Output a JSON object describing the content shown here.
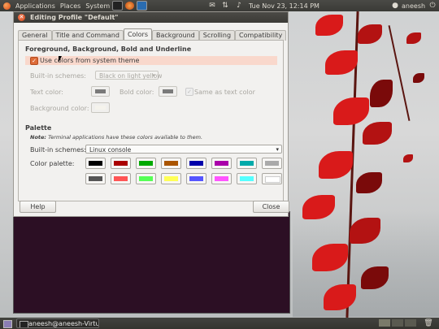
{
  "top_panel": {
    "menus": [
      "Applications",
      "Places",
      "System"
    ],
    "clock": "Tue Nov 23, 12:14 PM",
    "user": "aneesh"
  },
  "dialog": {
    "title": "Editing Profile \"Default\"",
    "tabs": [
      "General",
      "Title and Command",
      "Colors",
      "Background",
      "Scrolling",
      "Compatibility"
    ],
    "active_tab": "Colors",
    "fg_section": {
      "heading": "Foreground, Background, Bold and Underline",
      "use_system_theme_label": "Use colors from system theme",
      "use_system_theme_checked": true,
      "builtin_schemes_label": "Built-in schemes:",
      "builtin_schemes_value": "Black on light yellow",
      "text_color_label": "Text color:",
      "text_color": "#7a7a7a",
      "bold_color_label": "Bold color:",
      "bold_color": "#7a7a7a",
      "same_as_text_label": "Same as text color",
      "same_as_text_checked": true,
      "background_color_label": "Background color:",
      "background_color": "#f5f3ec"
    },
    "palette_section": {
      "heading": "Palette",
      "note_bold": "Note:",
      "note_text": " Terminal applications have these colors available to them.",
      "builtin_schemes_label": "Built-in schemes:",
      "builtin_schemes_value": "Linux console",
      "color_palette_label": "Color palette:",
      "row1": [
        "#000000",
        "#aa0000",
        "#00aa00",
        "#aa5500",
        "#0000aa",
        "#aa00aa",
        "#00aaaa",
        "#aaaaaa"
      ],
      "row2": [
        "#555555",
        "#ff5555",
        "#55ff55",
        "#ffff55",
        "#5555ff",
        "#ff55ff",
        "#55ffff",
        "#ffffff"
      ]
    },
    "help_button": "Help",
    "close_button": "Close"
  },
  "taskbar": {
    "task_label": "aneesh@aneesh-Virtu..."
  },
  "colors": {
    "accent": "#dd4814",
    "terminal_bg": "#2c0f24",
    "panel_bg": "#3c3b37"
  }
}
